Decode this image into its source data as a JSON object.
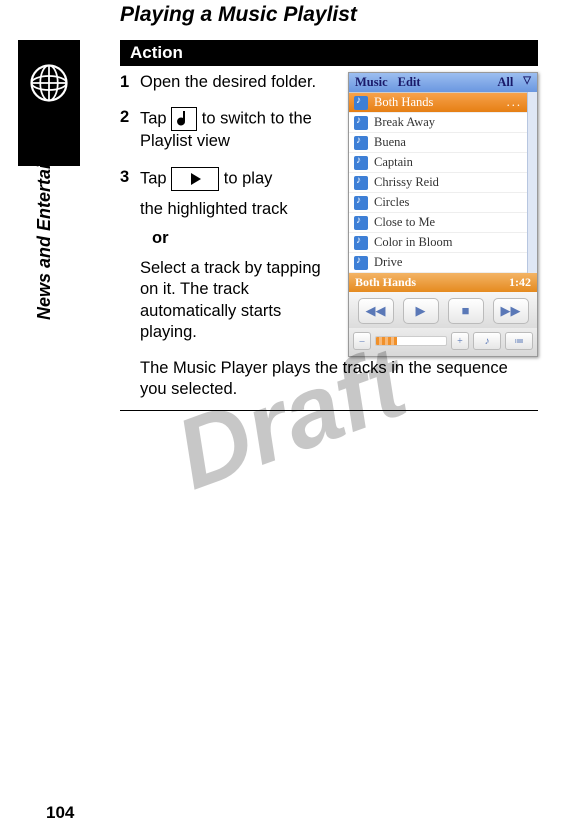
{
  "page_title": "Playing a Music Playlist",
  "side_label": "News and Entertainment",
  "action_header": "Action",
  "watermark": "Draft",
  "page_number": "104",
  "steps": {
    "s1": {
      "num": "1",
      "text": "Open the desired folder."
    },
    "s2": {
      "num": "2",
      "pre": "Tap ",
      "post": " to switch to the Playlist view"
    },
    "s3": {
      "num": "3",
      "pre": "Tap ",
      "post": " to play",
      "line2": "the highlighted track",
      "or": "or",
      "alt": "Select a track by tapping on it. The track automatically starts playing."
    }
  },
  "final_note": "The Music Player plays the tracks in the sequence you selected.",
  "phone": {
    "menu": {
      "music": "Music",
      "edit": "Edit",
      "all": "All"
    },
    "tracks": [
      "Both Hands",
      "Break Away",
      "Buena",
      "Captain",
      "Chrissy Reid",
      "Circles",
      "Close to Me",
      "Color in Bloom",
      "Drive"
    ],
    "nowplaying": {
      "title": "Both Hands",
      "time": "1:42"
    },
    "ellipsis": "..."
  }
}
